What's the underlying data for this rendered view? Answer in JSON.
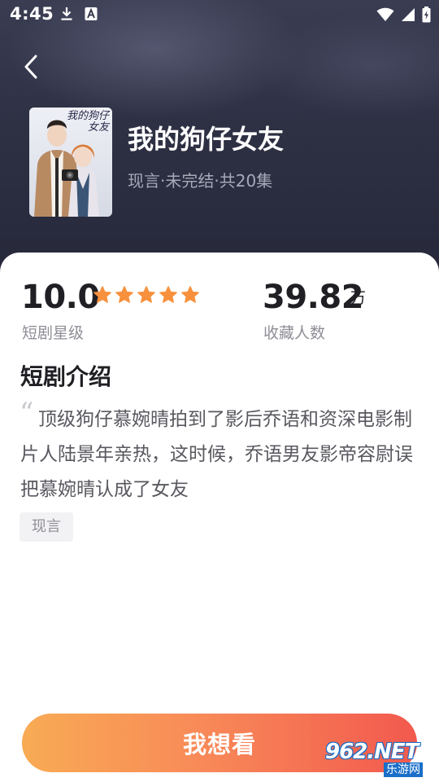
{
  "status_bar": {
    "time": "4:45",
    "left_icons": [
      "download-icon",
      "a-badge-icon"
    ],
    "right_icons": [
      "wifi-icon",
      "signal-icon",
      "battery-icon"
    ]
  },
  "header": {
    "back_icon": "chevron-left-icon"
  },
  "drama": {
    "title": "我的狗仔女友",
    "meta": "现言·未完结·共20集",
    "poster_title": "我的狗仔女友"
  },
  "stats": {
    "rating_value": "10.0",
    "rating_stars": 5,
    "rating_max": 5,
    "rating_label": "短剧星级",
    "favorites_value": "39.82",
    "favorites_unit": "万",
    "favorites_label": "收藏人数"
  },
  "intro": {
    "section_title": "短剧介绍",
    "quote_mark": "“",
    "synopsis": "顶级狗仔慕婉晴拍到了影后乔语和资深电影制片人陆景年亲热，这时候，乔语男友影帝容尉误把慕婉晴认成了女友",
    "tags": [
      "现言"
    ]
  },
  "cta": {
    "label": "我想看"
  },
  "watermark": {
    "main": "962.NET",
    "sub": "乐游网"
  },
  "colors": {
    "star": "#f7913d",
    "cta_start": "#f8ab54",
    "cta_end": "#f2594e",
    "hero_bg": "#2e3044"
  }
}
